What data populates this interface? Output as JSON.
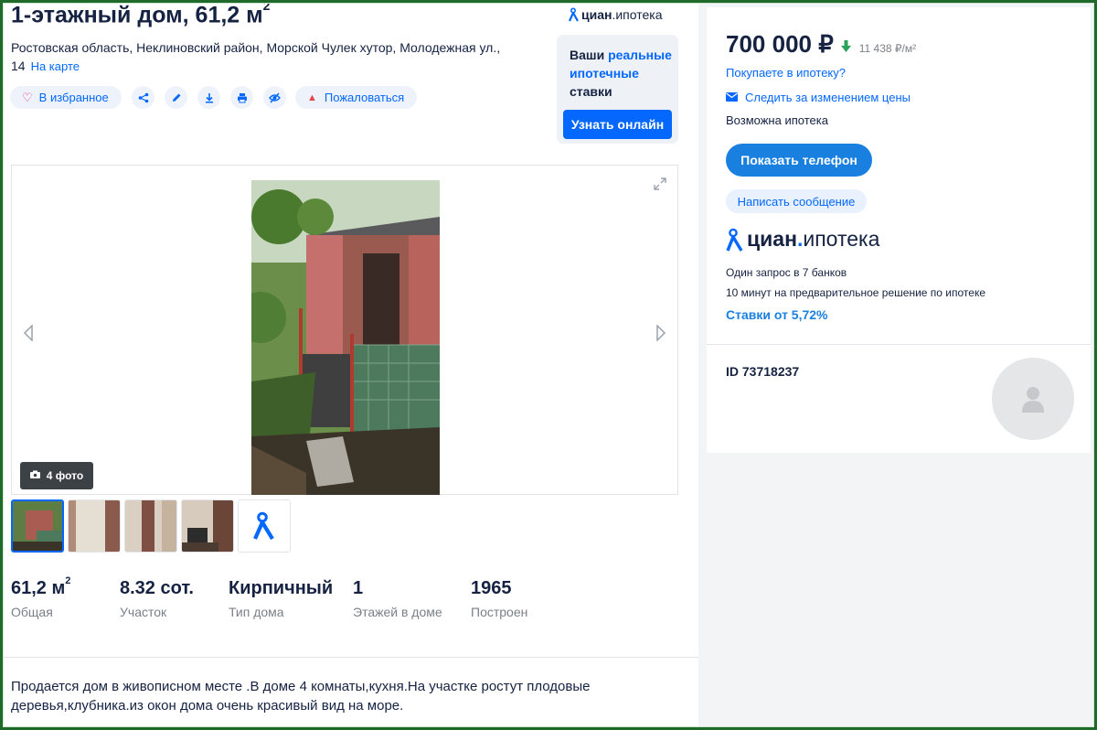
{
  "listing": {
    "title": "1-этажный дом, 61,2 м",
    "title_sup": "2",
    "address": "Ростовская область, Неклиновский район, Морской Чулек хутор, Молодежная ул., 14",
    "map_link": "На карте"
  },
  "actions": {
    "favorite_label": "В избранное",
    "report_label": "Пожаловаться",
    "icons": [
      "share-icon",
      "edit-icon",
      "download-icon",
      "print-icon",
      "hide-icon"
    ]
  },
  "promo": {
    "logo_main": "циан",
    "logo_rest": ".ипотека",
    "text_1": "Ваши ",
    "text_blue": "реальные ипотечные",
    "text_2": " ставки",
    "button": "Узнать онлайн"
  },
  "gallery": {
    "photo_count_label": "4 фото",
    "thumb_count": 5
  },
  "facts": [
    {
      "value": "61,2 м",
      "sup": "2",
      "label": "Общая"
    },
    {
      "value": "8.32 сот.",
      "sup": "",
      "label": "Участок"
    },
    {
      "value": "Кирпичный",
      "sup": "",
      "label": "Тип дома"
    },
    {
      "value": "1",
      "sup": "",
      "label": "Этажей в доме"
    },
    {
      "value": "1965",
      "sup": "",
      "label": "Построен"
    }
  ],
  "description": "Продается дом в живописном месте .В доме 4 комнаты,кухня.На участке ростут плодовые деревья,клубника.из окон дома очень красивый вид на море.",
  "sidebar": {
    "price": "700 000 ₽",
    "price_per_sqm": "11 438 ₽/м²",
    "mortgage_question": "Покупаете в ипотеку?",
    "follow_price": "Следить за изменением цены",
    "mortgage_possible": "Возможна ипотека",
    "show_phone": "Показать телефон",
    "write_message": "Написать сообщение",
    "logo_main": "циан",
    "logo_dot": ".",
    "logo_rest": "ипотека",
    "info_line_1": "Один запрос в 7 банков",
    "info_line_2": "10 минут на предварительное решение по ипотеке",
    "rate": "Ставки от 5,72%",
    "listing_id": "ID 73718237"
  },
  "colors": {
    "accent": "#0468ff",
    "button_blue": "#1a80e0",
    "price_down": "#2ca35a",
    "frame": "#1f6a2a"
  }
}
